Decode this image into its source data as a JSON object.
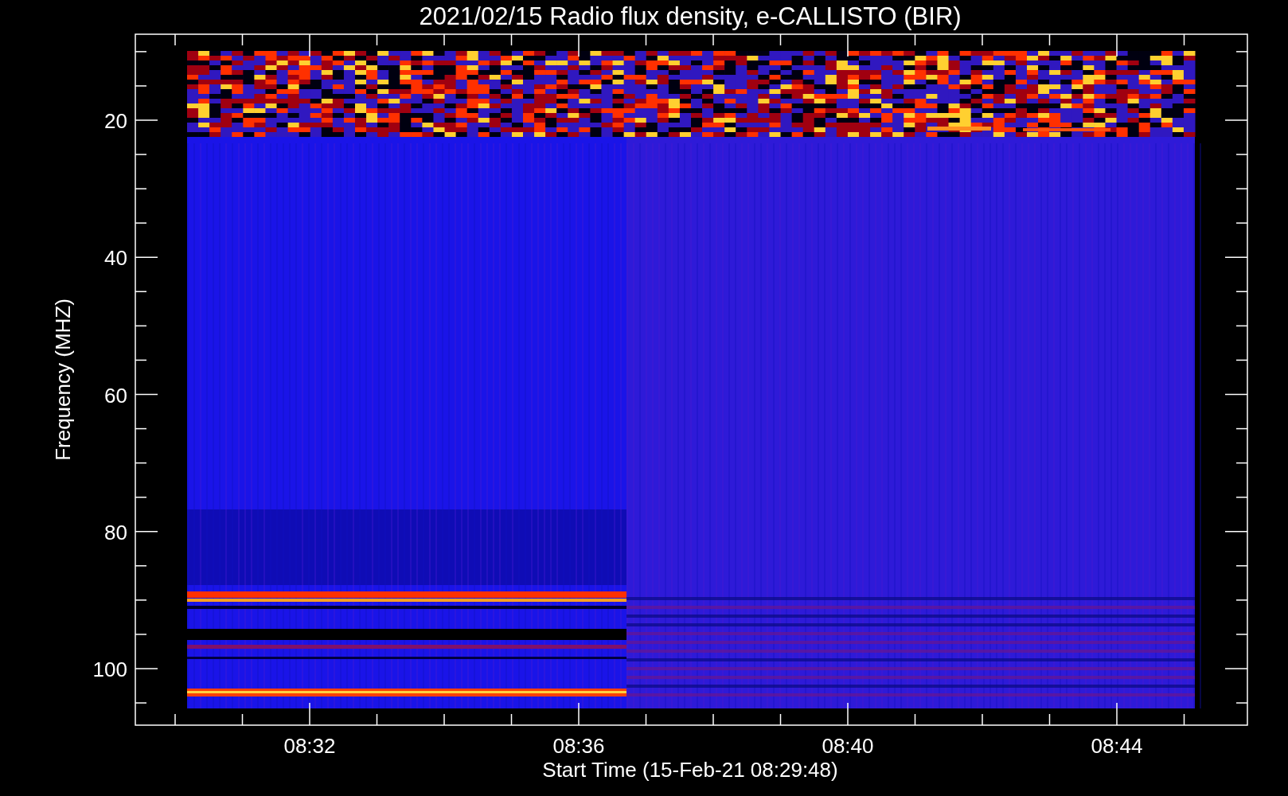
{
  "plot": {
    "title": "2021/02/15  Radio flux density, e-CALLISTO (BIR)",
    "ylabel": "Frequency (MHZ)",
    "xlabel": "Start Time (15-Feb-21 08:29:48)",
    "yticks": [
      "20",
      "40",
      "60",
      "80",
      "100"
    ],
    "xticks": [
      "08:32",
      "08:36",
      "08:40",
      "08:44"
    ]
  }
}
